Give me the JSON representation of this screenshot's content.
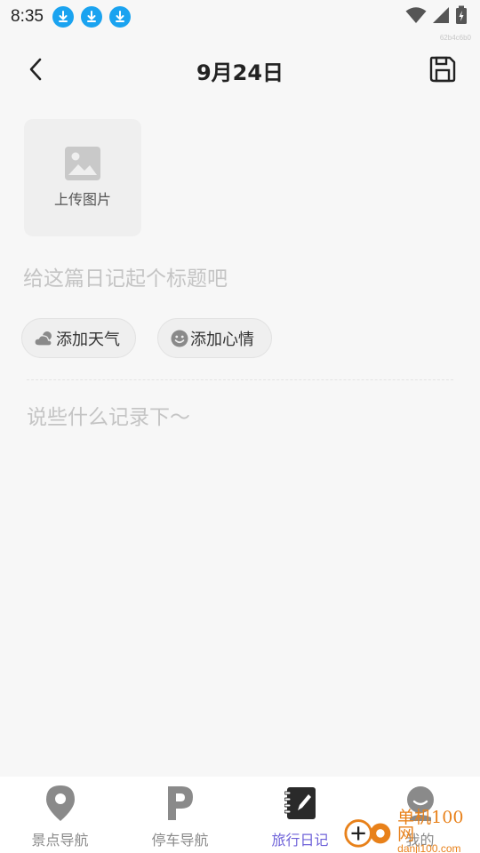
{
  "status_bar": {
    "time": "8:35",
    "device_code": "62b4c6b0",
    "download_icon_color": "#1aa3f0"
  },
  "header": {
    "title": "9月24日"
  },
  "upload": {
    "label": "上传图片"
  },
  "title_field": {
    "placeholder": "给这篇日记起个标题吧",
    "value": ""
  },
  "chips": {
    "weather_label": "添加天气",
    "mood_label": "添加心情"
  },
  "content_field": {
    "placeholder": "说些什么记录下～",
    "value": ""
  },
  "tabbar": {
    "items": [
      {
        "label": "景点导航",
        "icon": "location-pin-icon"
      },
      {
        "label": "停车导航",
        "icon": "parking-icon"
      },
      {
        "label": "旅行日记",
        "icon": "diary-notebook-icon"
      },
      {
        "label": "我的",
        "icon": "profile-icon"
      }
    ],
    "active_color": "#6f63d9",
    "inactive_color": "#8a8a8a"
  },
  "watermark": {
    "name": "单机100网",
    "url": "danji100.com"
  }
}
